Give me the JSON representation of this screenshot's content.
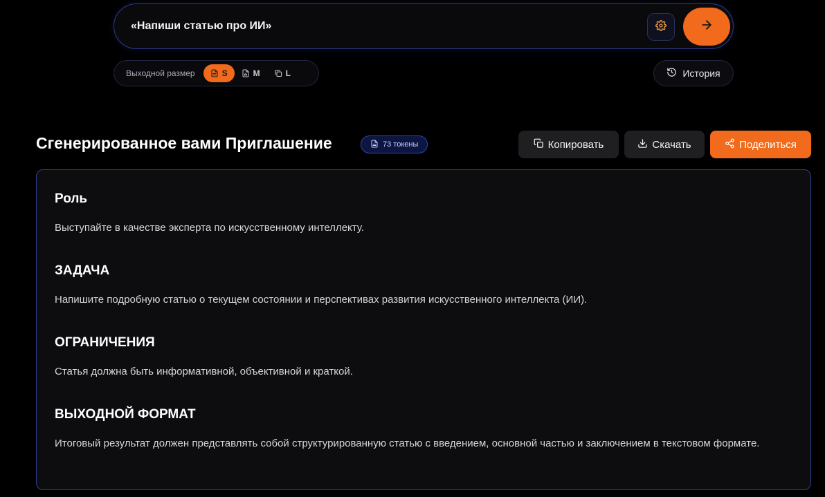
{
  "prompt": {
    "text": "«Напиши статью про ИИ»"
  },
  "size_selector": {
    "label": "Выходной размер",
    "options": [
      {
        "label": "S",
        "icon": "document-icon",
        "active": true
      },
      {
        "label": "M",
        "icon": "document-chart-icon",
        "active": false
      },
      {
        "label": "L",
        "icon": "copy-stack-icon",
        "active": false
      }
    ]
  },
  "history": {
    "label": "История",
    "icon": "history-icon"
  },
  "result": {
    "title": "Сгенерированное вами Приглашение",
    "token_badge": "73 токены",
    "actions": {
      "copy": "Копировать",
      "download": "Скачать",
      "share": "Поделиться"
    },
    "sections": [
      {
        "heading": "Роль",
        "text": "Выступайте в качестве эксперта по искусственному интеллекту."
      },
      {
        "heading": "ЗАДАЧА",
        "text": "Напишите подробную статью о текущем состоянии и перспективах развития искусственного интеллекта (ИИ)."
      },
      {
        "heading": "ОГРАНИЧЕНИЯ",
        "text": "Статья должна быть информативной, объективной и краткой."
      },
      {
        "heading": "ВЫХОДНОЙ ФОРМАТ",
        "text": "Итоговый результат должен представлять собой структурированную статью с введением, основной частью и заключением в текстовом формате."
      }
    ]
  },
  "colors": {
    "accent": "#f26a1b",
    "background": "#000000",
    "card_border": "#2f3f8f",
    "badge_border": "#3147a8"
  }
}
